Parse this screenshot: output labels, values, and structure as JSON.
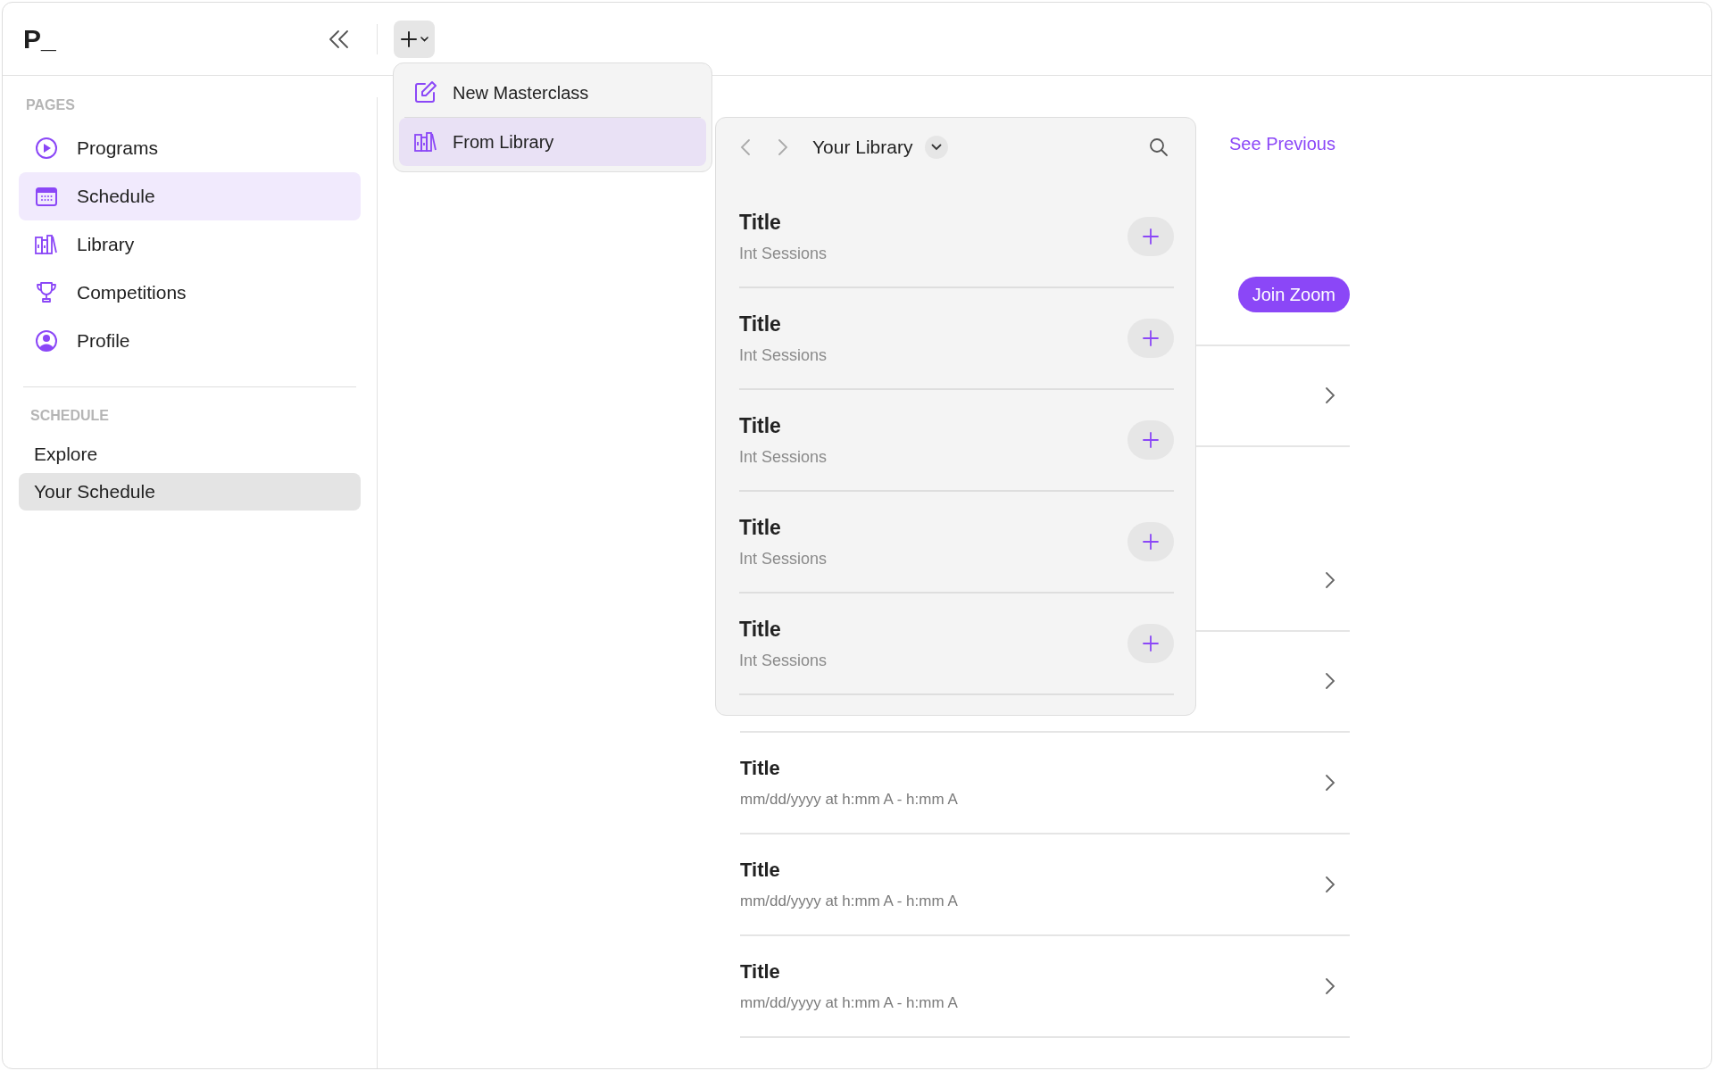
{
  "app": {
    "logo": "P_"
  },
  "sidebar": {
    "sections": [
      {
        "heading": "PAGES",
        "kind": "nav",
        "items": [
          {
            "label": "Programs",
            "selected": false
          },
          {
            "label": "Schedule",
            "selected": true
          },
          {
            "label": "Library",
            "selected": false
          },
          {
            "label": "Competitions",
            "selected": false
          },
          {
            "label": "Profile",
            "selected": false
          }
        ]
      },
      {
        "heading": "SCHEDULE",
        "kind": "plain",
        "items": [
          {
            "label": "Explore",
            "selected": false
          },
          {
            "label": "Your Schedule",
            "selected": true
          }
        ]
      }
    ]
  },
  "add_menu": {
    "items": [
      {
        "label": "New Masterclass",
        "selected": false
      },
      {
        "label": "From Library",
        "selected": true
      }
    ]
  },
  "library_popover": {
    "title": "Your Library",
    "items": [
      {
        "title": "Title",
        "subtitle": "Int Sessions"
      },
      {
        "title": "Title",
        "subtitle": "Int Sessions"
      },
      {
        "title": "Title",
        "subtitle": "Int Sessions"
      },
      {
        "title": "Title",
        "subtitle": "Int Sessions"
      },
      {
        "title": "Title",
        "subtitle": "Int Sessions"
      }
    ]
  },
  "schedule": {
    "link": "See Previous",
    "rows": [
      {
        "kind": "join",
        "button": "Join Zoom"
      },
      {
        "kind": "chevron"
      },
      {
        "kind": "chevron"
      },
      {
        "kind": "chevron"
      },
      {
        "kind": "event",
        "title": "Title",
        "time": "mm/dd/yyyy at h:mm A - h:mm A"
      },
      {
        "kind": "event",
        "title": "Title",
        "time": "mm/dd/yyyy at h:mm A - h:mm A"
      },
      {
        "kind": "event",
        "title": "Title",
        "time": "mm/dd/yyyy at h:mm A - h:mm A"
      }
    ]
  }
}
